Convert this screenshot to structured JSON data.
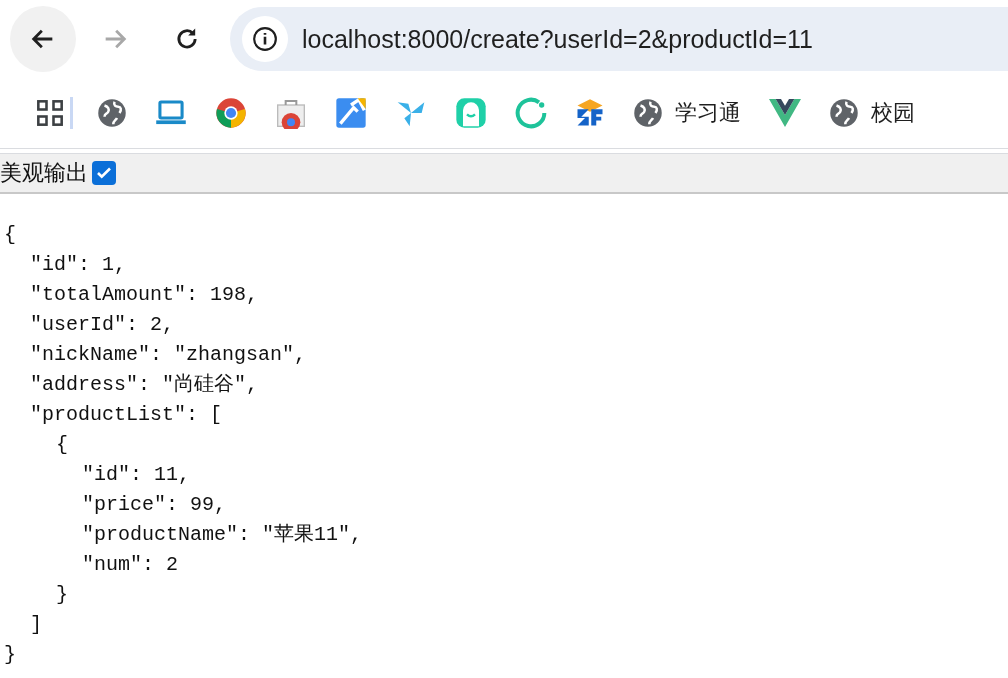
{
  "address_bar": {
    "url": "localhost:8000/create?userId=2&productId=11"
  },
  "bookmarks": [
    {
      "label": "学习通"
    },
    {
      "label": "校园"
    }
  ],
  "pretty_print": {
    "label": "美观输出",
    "checked": true
  },
  "json_lines": [
    {
      "text": "{",
      "children": [
        {
          "text": "\"id\": 1,"
        },
        {
          "text": "\"totalAmount\": 198,"
        },
        {
          "text": "\"userId\": 2,"
        },
        {
          "text": "\"nickName\": \"zhangsan\","
        },
        {
          "text": "\"address\": \"尚硅谷\","
        },
        {
          "text": "\"productList\": [",
          "children": [
            {
              "text": "{",
              "children": [
                {
                  "text": "\"id\": 11,"
                },
                {
                  "text": "\"price\": 99,"
                },
                {
                  "text": "\"productName\": \"苹果11\","
                },
                {
                  "text": "\"num\": 2"
                }
              ]
            },
            {
              "text": "}"
            }
          ]
        },
        {
          "text": "]"
        }
      ]
    },
    {
      "text": "}"
    }
  ]
}
